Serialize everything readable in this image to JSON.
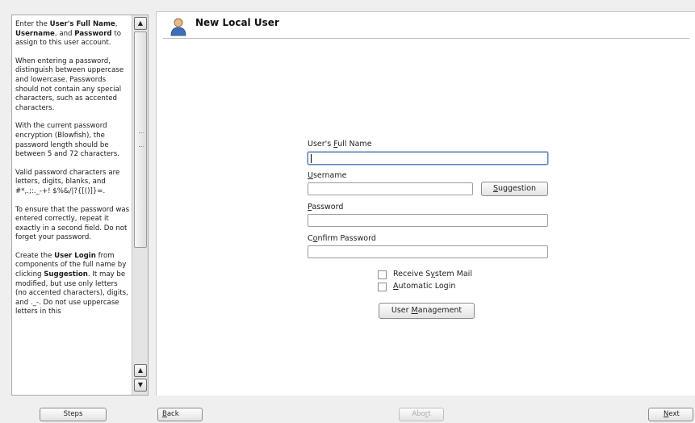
{
  "help": {
    "paragraphs": [
      "Enter the <b>User's Full Name</b>, <b>Username</b>, and <b>Password</b> to assign to this user account.",
      "When entering a password, distinguish between uppercase and lowercase. Passwords should not contain any special characters, such as accented characters.",
      "With the current password encryption (Blowfish), the password length should be between 5 and 72 characters.",
      "Valid password characters are letters, digits, blanks, and #*,.;:._-+! $%&/|?{[()]}=.",
      "To ensure that the password was entered correctly, repeat it exactly in a second field. Do not forget your password.",
      "Create the <b>User Login</b> from components of the full name by clicking <b>Suggestion</b>. It may be modified, but use only letters (no accented characters), digits, and ._-. Do not use uppercase letters in this"
    ]
  },
  "header": {
    "title": "New Local User"
  },
  "form": {
    "full_name": {
      "label_pre": "User's ",
      "label_key": "F",
      "label_post": "ull Name",
      "value": ""
    },
    "username": {
      "label_pre": "",
      "label_key": "U",
      "label_post": "sername",
      "value": ""
    },
    "suggestion_button": {
      "label_pre": "",
      "label_key": "S",
      "label_post": "uggestion"
    },
    "password": {
      "label_pre": "",
      "label_key": "P",
      "label_post": "assword",
      "value": ""
    },
    "confirm_password": {
      "label_pre": "C",
      "label_key": "o",
      "label_post": "nfirm Password",
      "value": ""
    },
    "receive_mail": {
      "label_pre": "Receive S",
      "label_key": "y",
      "label_post": "stem Mail",
      "checked": false
    },
    "auto_login": {
      "label_pre": "",
      "label_key": "A",
      "label_post": "utomatic Login",
      "checked": false
    },
    "user_management_button": {
      "label_pre": "User ",
      "label_key": "M",
      "label_post": "anagement"
    }
  },
  "footer": {
    "steps_label": "Steps",
    "back_label_key": "B",
    "back_label_post": "ack",
    "abort_label_pre": "Abo",
    "abort_label_key": "r",
    "abort_label_post": "t",
    "next_label_key": "N",
    "next_label_post": "ext"
  },
  "icons": {
    "scroll_up": "scroll-up-icon",
    "scroll_down": "scroll-down-icon",
    "user": "user-icon"
  }
}
